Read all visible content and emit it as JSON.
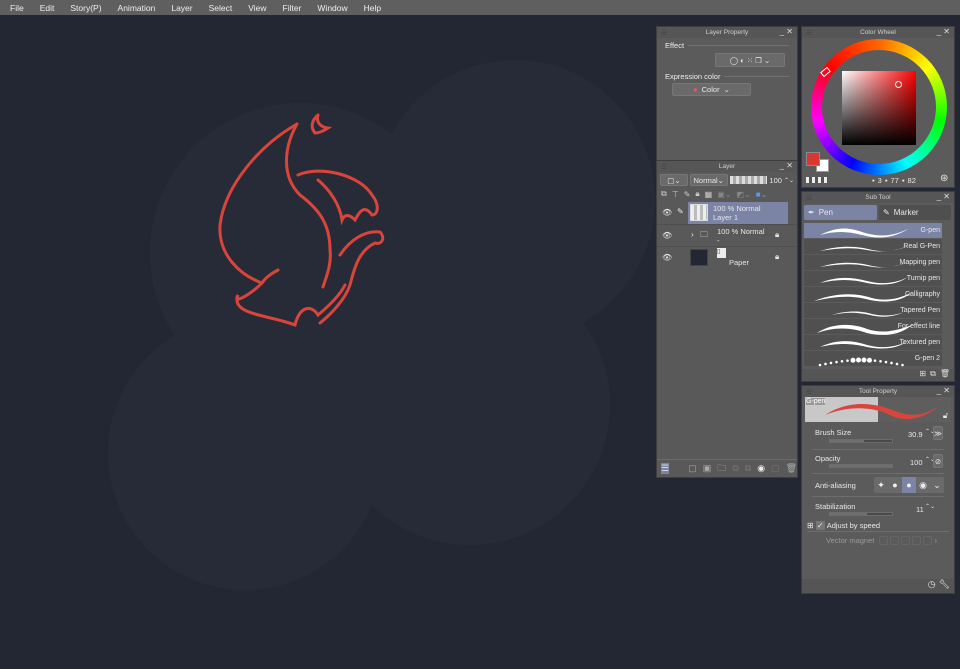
{
  "menu": [
    "File",
    "Edit",
    "Story(P)",
    "Animation",
    "Layer",
    "Select",
    "View",
    "Filter",
    "Window",
    "Help"
  ],
  "layer_property": {
    "title": "Layer Property",
    "effect_label": "Effect",
    "expression_color_label": "Expression color",
    "expression_color_value": "Color"
  },
  "layer": {
    "title": "Layer",
    "blend_mode": "Normal",
    "opacity": "100",
    "layers": [
      {
        "mode": "100 % Normal",
        "name": "Layer 1",
        "selected": true
      },
      {
        "mode": "100 % Normal",
        "name": "-",
        "folder": true
      },
      {
        "mode": "",
        "name": "Paper"
      }
    ]
  },
  "color_wheel": {
    "title": "Color Wheel",
    "main_color": "#d8382e",
    "sub_color": "#ffffff",
    "h": "3",
    "s": "77",
    "v": "82"
  },
  "sub_tool": {
    "title": "Sub Tool",
    "tabs": [
      "Pen",
      "Marker"
    ],
    "items": [
      "G-pen",
      "Real G-Pen",
      "Mapping pen",
      "Turnip pen",
      "Calligraphy",
      "Tapered Pen",
      "For effect line",
      "Textured pen",
      "G-pen 2"
    ],
    "selected": 0
  },
  "tool_property": {
    "title": "Tool Property",
    "preview_label": "G-pen",
    "brush_size_label": "Brush Size",
    "brush_size": "30.9",
    "brush_size_fraction": 0.55,
    "opacity_label": "Opacity",
    "opacity": "100",
    "opacity_fraction": 1.0,
    "anti_aliasing_label": "Anti-aliasing",
    "anti_aliasing_selected": 2,
    "stabilization_label": "Stabilization",
    "stabilization": "11",
    "stabilization_fraction": 0.6,
    "adjust_by_speed_label": "Adjust by speed",
    "adjust_by_speed": true,
    "vector_magnet_label": "Vector magnet"
  },
  "colors": {
    "stroke": "#d9453a",
    "canvas": "#232733",
    "accent": "#7c84a6"
  }
}
